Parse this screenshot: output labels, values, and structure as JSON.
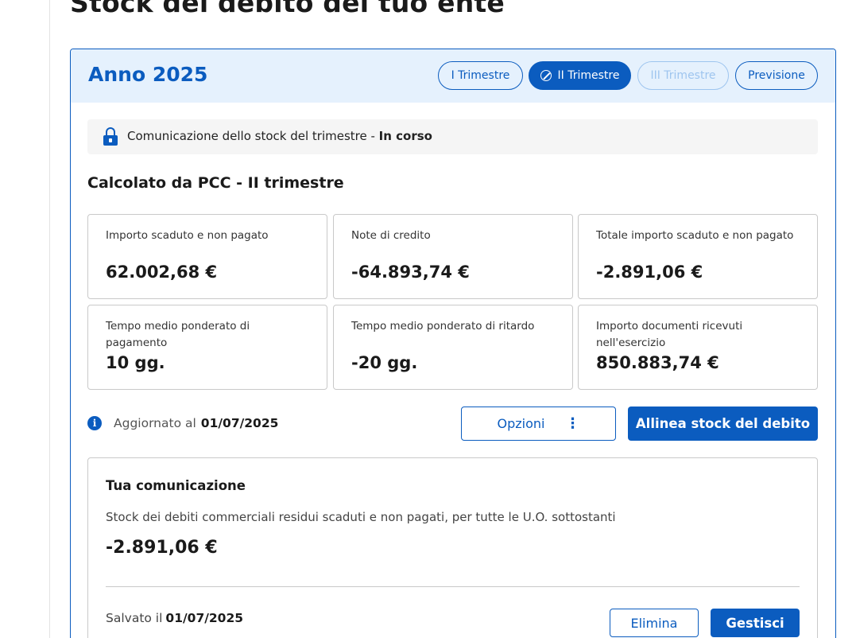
{
  "page": {
    "title": "Stock del debito del tuo ente"
  },
  "card": {
    "year_title": "Anno 2025",
    "tabs": [
      {
        "label": "I Trimestre",
        "state": "default"
      },
      {
        "label": "II Trimestre",
        "state": "active"
      },
      {
        "label": "III Trimestre",
        "state": "disabled"
      },
      {
        "label": "Previsione",
        "state": "default"
      }
    ]
  },
  "banner": {
    "icon": "lock-icon",
    "text": "Comunicazione dello stock del trimestre - ",
    "status": "In corso"
  },
  "section": {
    "title": "Calcolato da PCC - II trimestre"
  },
  "metrics": [
    {
      "label": "Importo scaduto e non pagato",
      "value": "62.002,68 €"
    },
    {
      "label": "Note di credito",
      "value": "-64.893,74 €"
    },
    {
      "label": "Totale importo scaduto e non pagato",
      "value": "-2.891,06 €"
    },
    {
      "label": "Tempo medio ponderato di pagamento",
      "value": "10 gg."
    },
    {
      "label": "Tempo medio ponderato di ritardo",
      "value": "-20 gg."
    },
    {
      "label": "Importo documenti ricevuti nell'esercizio",
      "value": "850.883,74 €"
    }
  ],
  "update": {
    "icon": "info-icon",
    "prefix": "Aggiornato al",
    "date": "01/07/2025"
  },
  "actions": {
    "options_label": "Opzioni",
    "options_icon": "more-vertical-icon",
    "align_label": "Allinea stock del debito"
  },
  "communication": {
    "title": "Tua comunicazione",
    "description": "Stock dei debiti commerciali residui scaduti e non pagati, per tutte le U.O. sottostanti",
    "value": "-2.891,06 €",
    "saved_prefix": "Salvato il",
    "saved_date": "01/07/2025",
    "delete_label": "Elimina",
    "manage_label": "Gestisci"
  },
  "colors": {
    "primary": "#0b5cbf",
    "header_bg": "#e5f1fd",
    "banner_bg": "#f5f5f5",
    "border": "#c9c9c9",
    "disabled": "#9ec5ef"
  }
}
